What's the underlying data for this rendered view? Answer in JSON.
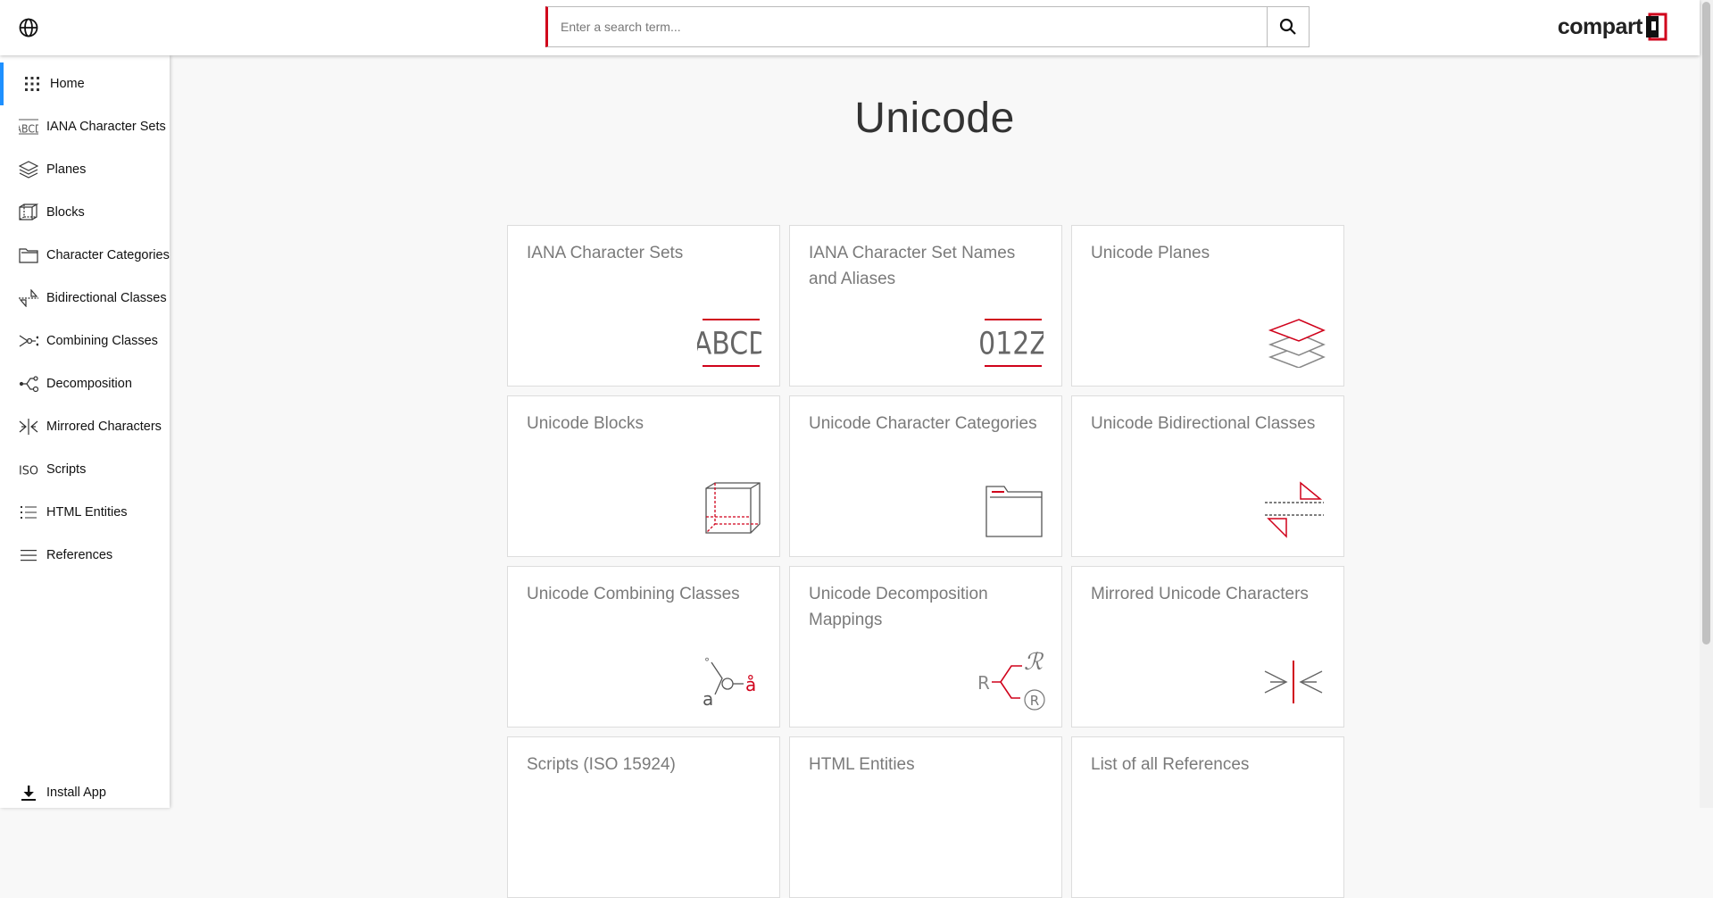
{
  "header": {
    "search_placeholder": "Enter a search term...",
    "logo_text": "compart"
  },
  "sidebar": {
    "items": [
      {
        "label": "Home",
        "icon": "grid-icon",
        "active": true
      },
      {
        "label": "IANA Character Sets",
        "icon": "abcd-icon"
      },
      {
        "label": "Planes",
        "icon": "layers-icon"
      },
      {
        "label": "Blocks",
        "icon": "cube-icon"
      },
      {
        "label": "Character Categories",
        "icon": "folder-icon"
      },
      {
        "label": "Bidirectional Classes",
        "icon": "bidi-icon"
      },
      {
        "label": "Combining Classes",
        "icon": "combining-icon"
      },
      {
        "label": "Decomposition",
        "icon": "decomposition-icon"
      },
      {
        "label": "Mirrored Characters",
        "icon": "mirror-icon"
      },
      {
        "label": "Scripts",
        "icon": "iso-icon"
      },
      {
        "label": "HTML Entities",
        "icon": "list-icon"
      },
      {
        "label": "References",
        "icon": "menu-icon"
      }
    ],
    "install_label": "Install App"
  },
  "main": {
    "title": "Unicode",
    "cards": [
      {
        "title": "IANA Character Sets",
        "icon": "abcd-icon"
      },
      {
        "title": "IANA Character Set Names and Aliases",
        "icon": "digits-icon"
      },
      {
        "title": "Unicode Planes",
        "icon": "layers-icon"
      },
      {
        "title": "Unicode Blocks",
        "icon": "cube-icon"
      },
      {
        "title": "Unicode Character Categories",
        "icon": "folder-icon"
      },
      {
        "title": "Unicode Bidirectional Classes",
        "icon": "bidi-icon"
      },
      {
        "title": "Unicode Combining Classes",
        "icon": "combining-icon"
      },
      {
        "title": "Unicode Decomposition Mappings",
        "icon": "decomposition-icon"
      },
      {
        "title": "Mirrored Unicode Characters",
        "icon": "mirror-icon"
      },
      {
        "title": "Scripts (ISO 15924)",
        "icon": "iso-icon"
      },
      {
        "title": "HTML Entities",
        "icon": "list-icon"
      },
      {
        "title": "List of all References",
        "icon": "menu-icon"
      }
    ]
  },
  "icon_text": {
    "abcd": "ABCD",
    "digits": "012Z",
    "combining_a": "a",
    "combining_ring": "å",
    "combining_circle": "°",
    "decomp_r": "R",
    "decomp_script_r": "ℛ",
    "decomp_circled_r": "R",
    "iso": "ISO"
  },
  "colors": {
    "accent": "#d0021b",
    "active": "#1e90ff"
  }
}
